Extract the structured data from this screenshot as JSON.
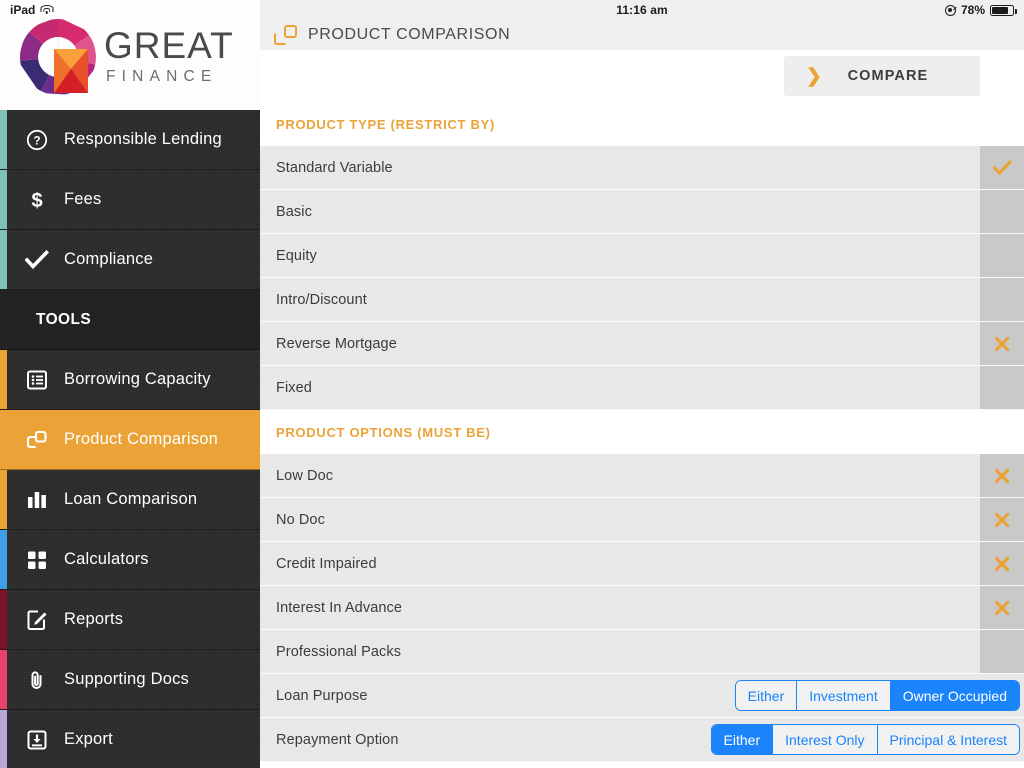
{
  "status_bar": {
    "device": "iPad",
    "wifi_icon": "wifi-icon",
    "time": "11:16 am",
    "rotation_lock_icon": "rotation-lock-icon",
    "battery_percent": "78%",
    "battery_icon": "battery-icon"
  },
  "brand": {
    "name_top": "GREAT",
    "name_bottom": "FINANCE",
    "logo_icon": "great-finance-logo"
  },
  "sidebar": {
    "items": [
      {
        "label": "Responsible Lending",
        "icon": "question-circle-icon",
        "accent": "#7fc0b8",
        "active": false
      },
      {
        "label": "Fees",
        "icon": "dollar-icon",
        "accent": "#7fc0b8",
        "active": false
      },
      {
        "label": "Compliance",
        "icon": "check-icon",
        "accent": "#7fc0b8",
        "active": false
      }
    ],
    "section_label": "TOOLS",
    "tools": [
      {
        "label": "Borrowing Capacity",
        "icon": "list-form-icon",
        "accent": "#eba338",
        "active": false
      },
      {
        "label": "Product Comparison",
        "icon": "compare-squares-icon",
        "accent": "#eba338",
        "active": true
      },
      {
        "label": "Loan Comparison",
        "icon": "bar-chart-icon",
        "accent": "#eba338",
        "active": false
      },
      {
        "label": "Calculators",
        "icon": "grid-squares-icon",
        "accent": "#3fa0e8",
        "active": false
      },
      {
        "label": "Reports",
        "icon": "edit-document-icon",
        "accent": "#7b1226",
        "active": false
      },
      {
        "label": "Supporting Docs",
        "icon": "paperclip-icon",
        "accent": "#e8436b",
        "active": false
      },
      {
        "label": "Export",
        "icon": "download-box-icon",
        "accent": "#b8a9d9",
        "active": false
      }
    ]
  },
  "header": {
    "icon": "compare-squares-icon",
    "title": "PRODUCT COMPARISON"
  },
  "toolbar": {
    "compare_label": "COMPARE",
    "compare_chevron": "chevron-right-icon"
  },
  "cart_column": {
    "icon": "shopping-cart-icon"
  },
  "sections": [
    {
      "title": "PRODUCT TYPE (RESTRICT BY)",
      "rows": [
        {
          "label": "Standard Variable",
          "mark": "check",
          "mark_icon": "check-icon"
        },
        {
          "label": "Basic",
          "mark": "none",
          "mark_icon": ""
        },
        {
          "label": "Equity",
          "mark": "none",
          "mark_icon": ""
        },
        {
          "label": "Intro/Discount",
          "mark": "none",
          "mark_icon": ""
        },
        {
          "label": "Reverse Mortgage",
          "mark": "cross",
          "mark_icon": "cross-icon"
        },
        {
          "label": "Fixed",
          "mark": "none",
          "mark_icon": ""
        }
      ]
    },
    {
      "title": "PRODUCT OPTIONS (MUST BE)",
      "rows": [
        {
          "label": "Low Doc",
          "mark": "cross",
          "mark_icon": "cross-icon"
        },
        {
          "label": "No Doc",
          "mark": "cross",
          "mark_icon": "cross-icon"
        },
        {
          "label": "Credit Impaired",
          "mark": "cross",
          "mark_icon": "cross-icon"
        },
        {
          "label": "Interest In Advance",
          "mark": "cross",
          "mark_icon": "cross-icon"
        },
        {
          "label": "Professional Packs",
          "mark": "none",
          "mark_icon": ""
        }
      ],
      "segmented_rows": [
        {
          "label": "Loan Purpose",
          "options": [
            "Either",
            "Investment",
            "Owner Occupied"
          ],
          "selected": "Owner Occupied"
        },
        {
          "label": "Repayment Option",
          "options": [
            "Either",
            "Interest Only",
            "Principal & Interest"
          ],
          "selected": "Either"
        }
      ]
    }
  ],
  "colors": {
    "accent_orange": "#eba338",
    "ios_blue": "#1b84fb",
    "sidebar_dark": "#2b2b2b",
    "row_grey": "#e8e8e8",
    "mark_col_grey": "#c9c9c9"
  }
}
